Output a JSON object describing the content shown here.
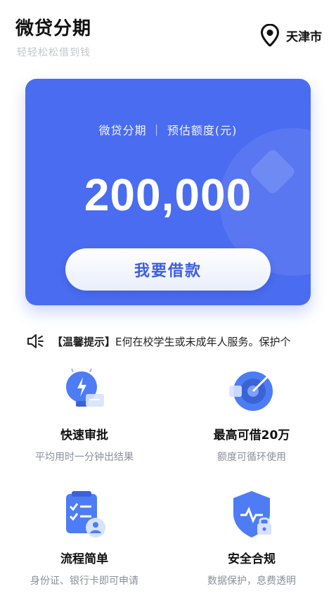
{
  "header": {
    "title": "微贷分期",
    "subtitle": "轻轻松松借到钱",
    "location_icon": "location-pin-icon",
    "city": "天津市"
  },
  "card": {
    "caption": "微贷分期 ｜ 预估额度(元)",
    "amount": "200,000",
    "button_label": "我要借款",
    "accent_color": "#4a6cf0"
  },
  "notice": {
    "icon": "speaker-icon",
    "label": "【温馨提示】",
    "text": "E何在校学生或未成年人服务。保护个"
  },
  "features": [
    {
      "icon": "lightbulb-icon",
      "title": "快速审批",
      "desc": "平均用时一分钟出结果"
    },
    {
      "icon": "target-icon",
      "title": "最高可借20万",
      "desc": "额度可循环使用"
    },
    {
      "icon": "checklist-icon",
      "title": "流程简单",
      "desc": "身份证、银行卡即可申请"
    },
    {
      "icon": "shield-icon",
      "title": "安全合规",
      "desc": "数据保护，息费透明"
    }
  ]
}
